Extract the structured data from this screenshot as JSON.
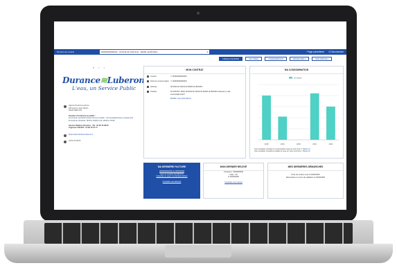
{
  "topbar": {
    "label": "Numéro de contrat",
    "select_value": "00000000000000 - 00 RUE DU MOULIN - 84000 LE BOURG",
    "prev_page": "Page précédente",
    "logout": "Déconnexion"
  },
  "actions": {
    "tableau": "TABLEAU DE BORD",
    "factures": "FACTURES",
    "consommation": "CONSOMMATION",
    "demarches": "DÉMARCHES ▾",
    "espace": "MON ESPACE ▾"
  },
  "pager": {
    "first": "«",
    "prev": "‹",
    "next": "›"
  },
  "logo": {
    "word_left": "Durance",
    "word_right": "Luberon",
    "tagline": "L'eau, un Service Public"
  },
  "contact": {
    "agency_lines": [
      "Agence Durance-Luberon",
      "390 avenue Jean Moulin",
      "84120 PERTUIS"
    ],
    "hours_title": "Horaires d'ouverture au public :",
    "hours_link": "Du lundi au vendredi (bureau fermé au public - Accueil téléphonique uniquement)",
    "hours_text": "Du lundi au Vendredi : 8h30 à 12h00 et de 13h30 à 17h00",
    "service_line": "Service Relation Abonnés : Tél : 04 90 79 38 65",
    "urgence_line": "Urgences 24h/24h : 04 90 79 57 77",
    "website": "https://www.durance-luberon.fr",
    "phone": "04 90 79 38 65"
  },
  "contrat": {
    "title": "MON CONTRAT",
    "rows": [
      {
        "key": "Contrat",
        "value": "n° 00000000000000"
      },
      {
        "key": "Point de consommation",
        "value": "n° 00000000000000"
      },
      {
        "key": "Adresse",
        "value": "00 RUE DU MOULIN 84000 LE BOURG"
      },
      {
        "key": "Titulaire",
        "value": "M DUPONT JEAN 00 RUE DU MOULIN 84000 LE BOURG Adresse e-mail : exemple@email.fr"
      }
    ],
    "link": "Modifier mes informations"
  },
  "conso": {
    "title": "MA CONSOMMATION",
    "note_1": "Vous souhaitez consulter la consommation d'eau de votre foyer ?",
    "note_1_link": "Cliquez ici",
    "note_2": "Vous souhaitez connaître la qualité de l'eau sur votre commune ?",
    "note_2_link": "Cliquez ici"
  },
  "chart_data": {
    "type": "bar",
    "categories": [
      "2018",
      "2019",
      "2020",
      "2021",
      "2022"
    ],
    "series": [
      {
        "name": "m3 relevé",
        "values": [
          80,
          42,
          0,
          84,
          60
        ]
      }
    ],
    "ylim": [
      0,
      100
    ],
    "grid": true,
    "legend": "top",
    "color": "#4fd1c5"
  },
  "facture": {
    "title": "MA DERNIÈRE FACTURE",
    "line_1": "0000000000000 du 00/00/0000",
    "line_2": "pour un montant de 000,00 €",
    "line_3": "Consulter ou payer ma dernière facture",
    "link": "Consulter mes factures"
  },
  "releve": {
    "title": "MON DERNIER RELEVÉ",
    "line_1": "Compteur : 0000000000",
    "line_2": "Index : 00",
    "line_3": "le 00/00/0000",
    "link": "Consulter mes relevés"
  },
  "demarches": {
    "title": "MES DERNIÈRES DÉMARCHES",
    "line_1": "Prise de rendez-vous le 00/00/0000",
    "line_2": "Réservation en cours de validation le 00/00/0000"
  },
  "colors": {
    "primary": "#1f4fa6",
    "accent": "#6abf4b",
    "bar": "#4fd1c5"
  }
}
